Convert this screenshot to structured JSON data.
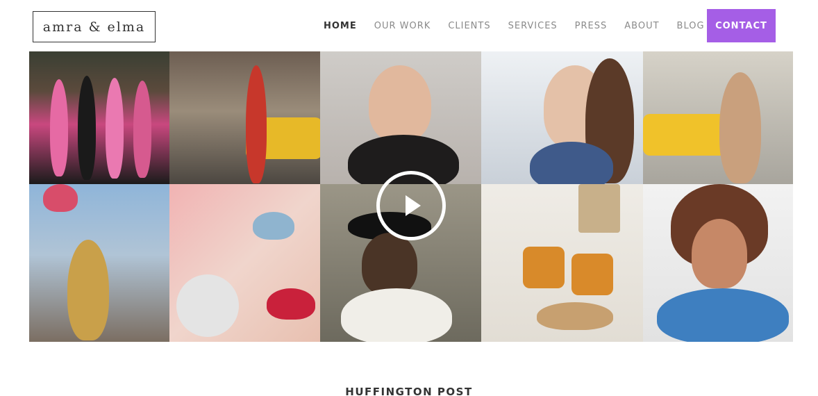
{
  "brand": {
    "logo_text": "amra & elma"
  },
  "nav": {
    "items": [
      {
        "label": "HOME",
        "active": true
      },
      {
        "label": "OUR WORK",
        "active": false
      },
      {
        "label": "CLIENTS",
        "active": false
      },
      {
        "label": "SERVICES",
        "active": false
      },
      {
        "label": "PRESS",
        "active": false
      },
      {
        "label": "ABOUT",
        "active": false
      },
      {
        "label": "BLOG",
        "active": false
      }
    ],
    "contact_label": "CONTACT"
  },
  "colors": {
    "accent": "#a55ee6",
    "text_dark": "#333333",
    "text_muted": "#8a8a8a"
  },
  "collage": {
    "play_icon": "play-icon",
    "tiles": [
      {
        "name": "photo-fashion-runway",
        "color": "#c9487f"
      },
      {
        "name": "photo-city-taxi-street",
        "color": "#9a8c7a"
      },
      {
        "name": "photo-woman-chocolate",
        "color": "#b8b2ad"
      },
      {
        "name": "photo-woman-winter-frost",
        "color": "#d9dde3"
      },
      {
        "name": "photo-woman-yellow-taxi",
        "color": "#b9b6ad"
      },
      {
        "name": "photo-woman-brooklyn-bridge",
        "color": "#8faecf"
      },
      {
        "name": "photo-lip-gloss-closeup",
        "color": "#e7a7a7"
      },
      {
        "name": "photo-man-black-hat",
        "color": "#7e7a6f"
      },
      {
        "name": "photo-tea-cookies-table",
        "color": "#e9e6e0"
      },
      {
        "name": "photo-curly-hair-woman",
        "color": "#b07458"
      }
    ]
  },
  "press": {
    "title": "HUFFINGTON POST"
  }
}
